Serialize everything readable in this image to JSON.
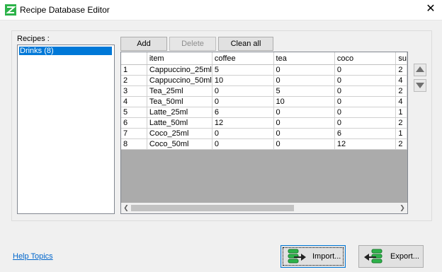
{
  "window": {
    "title": "Recipe Database Editor",
    "close_glyph": "✕"
  },
  "recipes": {
    "label": "Recipes :",
    "items": [
      "Drinks (8)"
    ]
  },
  "toolbar": {
    "add": "Add",
    "delete": "Delete",
    "clean_all": "Clean all"
  },
  "grid": {
    "columns": [
      "",
      "item",
      "coffee",
      "tea",
      "coco",
      "su"
    ],
    "rows": [
      [
        "1",
        "Cappuccino_25ml",
        "5",
        "0",
        "0",
        "2"
      ],
      [
        "2",
        "Cappuccino_50ml",
        "10",
        "0",
        "0",
        "4"
      ],
      [
        "3",
        "Tea_25ml",
        "0",
        "5",
        "0",
        "2"
      ],
      [
        "4",
        "Tea_50ml",
        "0",
        "10",
        "0",
        "4"
      ],
      [
        "5",
        "Latte_25ml",
        "6",
        "0",
        "0",
        "1"
      ],
      [
        "6",
        "Latte_50ml",
        "12",
        "0",
        "0",
        "2"
      ],
      [
        "7",
        "Coco_25ml",
        "0",
        "0",
        "6",
        "1"
      ],
      [
        "8",
        "Coco_50ml",
        "0",
        "0",
        "12",
        "2"
      ]
    ]
  },
  "footer": {
    "help": "Help Topics",
    "import": "Import...",
    "export": "Export..."
  },
  "colors": {
    "selection": "#0078d7",
    "link": "#0066cc",
    "icon_green": "#2db34a"
  }
}
